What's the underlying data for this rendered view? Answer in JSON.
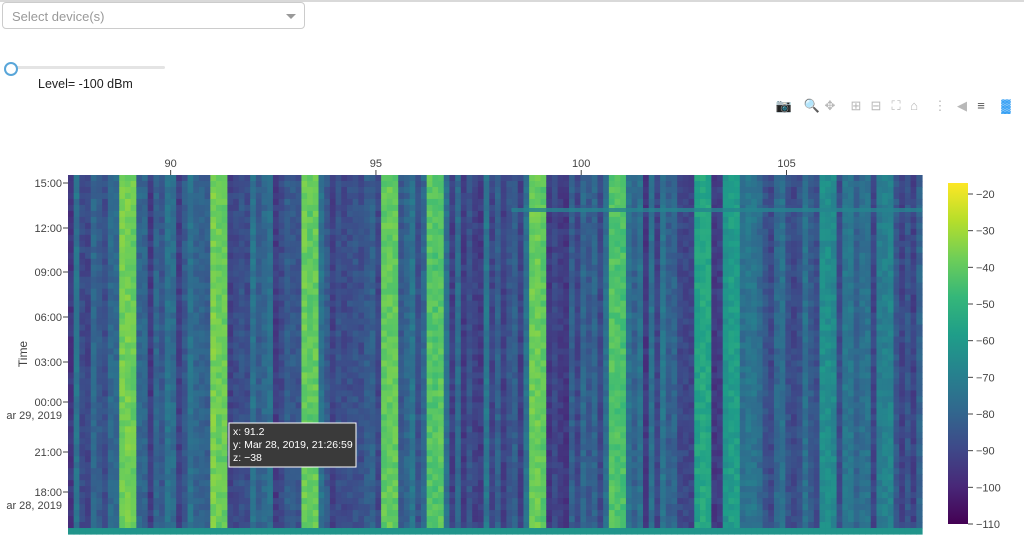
{
  "device_select": {
    "placeholder": "Select device(s)"
  },
  "level_slider": {
    "label": "Level= -100 dBm",
    "value": -100
  },
  "modebar": {
    "icons": [
      "camera-icon",
      "zoom-icon",
      "pan-icon",
      "zoom-in-icon",
      "zoom-out-icon",
      "autoscale-icon",
      "home-icon",
      "spike-lines-icon",
      "hover-closest-icon",
      "hover-compare-icon",
      "plotly-logo-icon"
    ]
  },
  "chart_data": {
    "type": "heatmap",
    "ylabel": "Time",
    "xticks": [
      90,
      95,
      100,
      105
    ],
    "xlim": [
      87.5,
      108.3
    ],
    "yticks": [
      {
        "label": "15:00",
        "sub": ""
      },
      {
        "label": "12:00",
        "sub": ""
      },
      {
        "label": "09:00",
        "sub": ""
      },
      {
        "label": "06:00",
        "sub": ""
      },
      {
        "label": "03:00",
        "sub": ""
      },
      {
        "label": "00:00",
        "sub": "ar 29, 2019"
      },
      {
        "label": "21:00",
        "sub": ""
      },
      {
        "label": "18:00",
        "sub": "ar 28, 2019"
      }
    ],
    "colorbar": {
      "ticks": [
        -20,
        -30,
        -40,
        -50,
        -60,
        -70,
        -80,
        -90,
        -100,
        -110
      ],
      "range": [
        -110,
        -17
      ],
      "colors": [
        "#440154",
        "#482878",
        "#3e4989",
        "#31688e",
        "#26828e",
        "#1f9e89",
        "#35b779",
        "#6ece58",
        "#b5de2b",
        "#fde725"
      ]
    },
    "bands": [
      {
        "x": 89.0,
        "z": -38
      },
      {
        "x": 91.2,
        "z": -38
      },
      {
        "x": 93.4,
        "z": -40
      },
      {
        "x": 95.3,
        "z": -40
      },
      {
        "x": 96.5,
        "z": -42
      },
      {
        "x": 98.9,
        "z": -40
      },
      {
        "x": 100.9,
        "z": -42
      },
      {
        "x": 102.9,
        "z": -55
      },
      {
        "x": 103.7,
        "z": -60
      },
      {
        "x": 106.0,
        "z": -65
      },
      {
        "x": 107.4,
        "z": -70
      }
    ],
    "tooltip": {
      "x": "x: 91.2",
      "y": "y: Mar 28, 2019, 21:26:59",
      "z": "z: −38"
    }
  }
}
